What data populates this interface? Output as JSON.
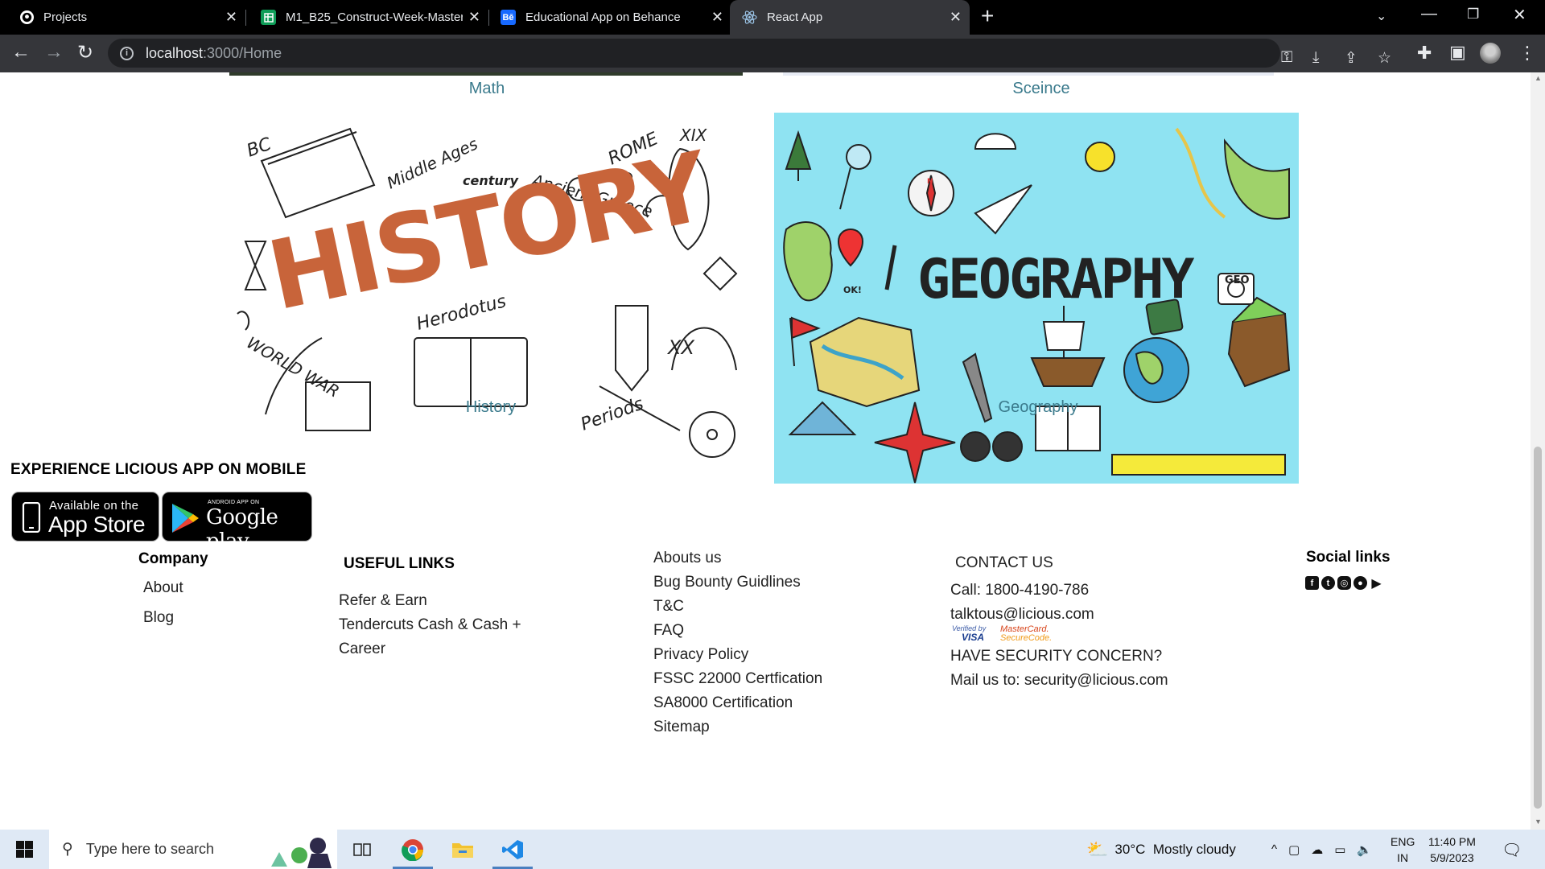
{
  "browser": {
    "tabs": [
      {
        "title": "Projects",
        "icon": "github-icon"
      },
      {
        "title": "M1_B25_Construct-Week-Master",
        "icon": "sheets-icon"
      },
      {
        "title": "Educational App on Behance",
        "icon": "behance-icon",
        "icon_text": "Bē"
      },
      {
        "title": "React App",
        "icon": "react-icon",
        "active": true
      }
    ],
    "url_host": "localhost",
    "url_rest": ":3000/Home"
  },
  "subjects": {
    "math_label": "Math",
    "science_label": "Sceince",
    "history_label": "History",
    "geography_label": "Geography",
    "history_image_text": "HISTORY",
    "geography_image_text": "GEOGRAPHY",
    "history_doodles": [
      "BC",
      "Middle Ages",
      "century",
      "Ancient Greece",
      "ROME",
      "XIX",
      "WORLD WAR",
      "Herodotus",
      "XX",
      "Periods"
    ],
    "geography_doodles": [
      "GEO",
      "N",
      "OK!"
    ]
  },
  "app_section": {
    "heading": "EXPERIENCE LICIOUS APP ON MOBILE",
    "app_store_small": "Available on the",
    "app_store_big": "App Store",
    "google_small": "ANDROID APP ON",
    "google_big": "Google play"
  },
  "footer": {
    "company": {
      "heading": "Company",
      "items": [
        "About",
        "Blog"
      ]
    },
    "useful_links": {
      "heading": "USEFUL LINKS",
      "items": [
        "Refer & Earn",
        "Tendercuts Cash & Cash +",
        "Career"
      ]
    },
    "more_links": {
      "items": [
        "Abouts us",
        "Bug Bounty Guidlines",
        "T&C",
        "FAQ",
        "Privacy Policy",
        "FSSC 22000 Certfication",
        "SA8000 Certification",
        "Sitemap"
      ]
    },
    "contact": {
      "heading": "CONTACT US",
      "call": "Call: 1800-4190-786",
      "email": "talktous@licious.com",
      "visa_text_1": "Verified by",
      "visa_text_2": "VISA",
      "mastercard_text_1": "MasterCard.",
      "mastercard_text_2": "SecureCode.",
      "security": "HAVE SECURITY CONCERN?",
      "mail": "Mail us to: security@licious.com"
    },
    "social": {
      "heading": "Social links",
      "icons": [
        "facebook-icon",
        "twitter-icon",
        "instagram-icon",
        "apple-icon",
        "play-icon"
      ]
    }
  },
  "taskbar": {
    "search_placeholder": "Type here to search",
    "weather": "30°C  Mostly cloudy",
    "lang_1": "ENG",
    "lang_2": "IN",
    "time": "11:40 PM",
    "date": "5/9/2023"
  },
  "colors": {
    "label_teal": "#3a7a8c",
    "history_orange": "#c8643a",
    "geo_bg": "#8fe3f2"
  }
}
